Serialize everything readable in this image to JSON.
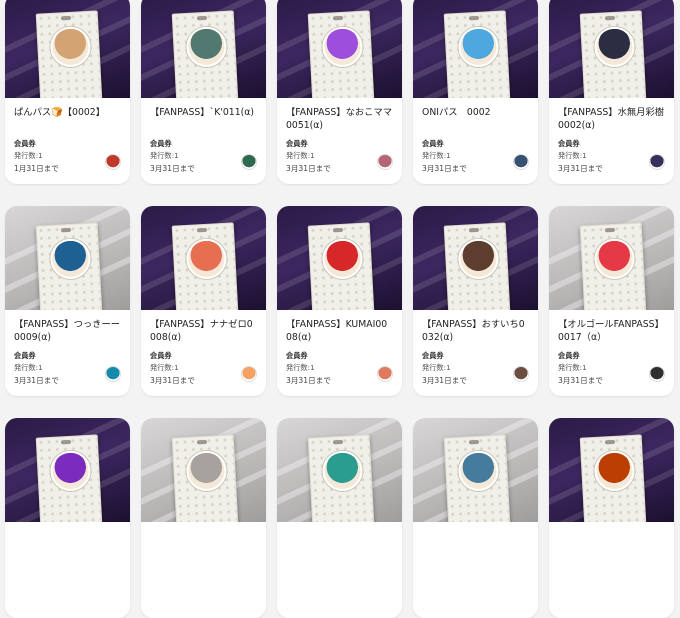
{
  "cards": [
    {
      "title": "ぱんパス🍞【0002】",
      "type": "会員券",
      "issued": "発行数:1",
      "until": "1月31日まで",
      "avatar_color": "#c0392b",
      "art": "dark",
      "portrait": "#d4a373"
    },
    {
      "title": "【FANPASS】`K'011(α)",
      "type": "会員券",
      "issued": "発行数:1",
      "until": "3月31日まで",
      "avatar_color": "#2d6a4f",
      "art": "dark",
      "portrait": "#52796f"
    },
    {
      "title": "【FANPASS】なおこママ0051(α)",
      "type": "会員券",
      "issued": "発行数:1",
      "until": "3月31日まで",
      "avatar_color": "#b56576",
      "art": "dark",
      "portrait": "#9d4edd"
    },
    {
      "title": "ONIパス　0002",
      "type": "会員券",
      "issued": "発行数:1",
      "until": "3月31日まで",
      "avatar_color": "#355070",
      "art": "dark",
      "portrait": "#4ea8de"
    },
    {
      "title": "【FANPASS】水無月彩樹0002(α)",
      "type": "会員券",
      "issued": "発行数:1",
      "until": "3月31日まで",
      "avatar_color": "#3a2e5c",
      "art": "dark",
      "portrait": "#2b2d42"
    },
    {
      "title": "【FANPASS】つっきーー0009(α)",
      "type": "会員券",
      "issued": "発行数:1",
      "until": "3月31日まで",
      "avatar_color": "#168aad",
      "art": "light",
      "portrait": "#1e6091"
    },
    {
      "title": "【FANPASS】ナナゼロ0008(α)",
      "type": "会員券",
      "issued": "発行数:1",
      "until": "3月31日まで",
      "avatar_color": "#f4a261",
      "art": "dark",
      "portrait": "#e76f51"
    },
    {
      "title": "【FANPASS】KUMAI0008(α)",
      "type": "会員券",
      "issued": "発行数:1",
      "until": "3月31日まで",
      "avatar_color": "#e07a5f",
      "art": "dark",
      "portrait": "#d62828"
    },
    {
      "title": "【FANPASS】おすいち0032(α)",
      "type": "会員券",
      "issued": "発行数:1",
      "until": "3月31日まで",
      "avatar_color": "#6d4c41",
      "art": "dark",
      "portrait": "#5c3d2e"
    },
    {
      "title": "【オルゴールFANPASS】0017（α）",
      "type": "会員券",
      "issued": "発行数:1",
      "until": "3月31日まで",
      "avatar_color": "#2f2f2f",
      "art": "light",
      "portrait": "#e63946"
    },
    {
      "title": "",
      "type": "",
      "issued": "",
      "until": "",
      "avatar_color": "#7b2cbf",
      "art": "dark",
      "portrait": "#7b2cbf"
    },
    {
      "title": "",
      "type": "",
      "issued": "",
      "until": "",
      "avatar_color": "#555",
      "art": "light",
      "portrait": "#a8a29e"
    },
    {
      "title": "",
      "type": "",
      "issued": "",
      "until": "",
      "avatar_color": "#2a9d8f",
      "art": "light",
      "portrait": "#2a9d8f"
    },
    {
      "title": "",
      "type": "",
      "issued": "",
      "until": "",
      "avatar_color": "#264653",
      "art": "light",
      "portrait": "#457b9d"
    },
    {
      "title": "",
      "type": "",
      "issued": "",
      "until": "",
      "avatar_color": "#9b2226",
      "art": "dark",
      "portrait": "#bb3e03"
    }
  ]
}
